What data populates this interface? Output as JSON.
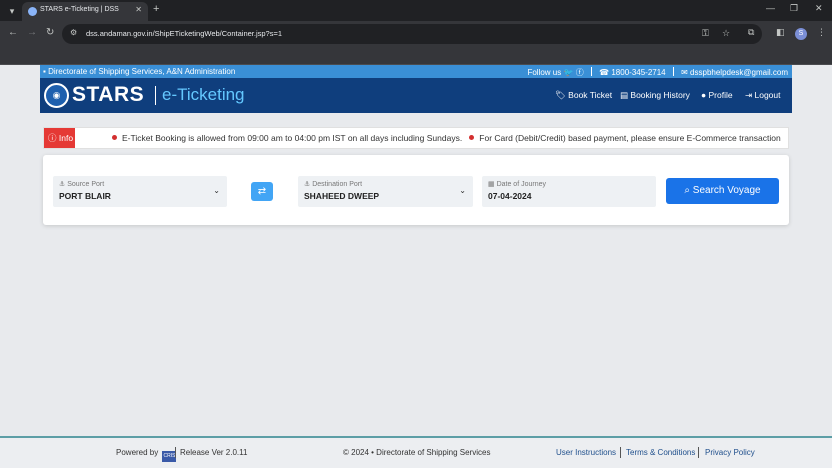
{
  "browser": {
    "tab_title": "STARS e-Ticketing | DSS",
    "tab_close": "✕",
    "new_tab": "+",
    "url": "dss.andaman.gov.in/ShipETicketingWeb/Container.jsp?s=1",
    "profile_initial": "S"
  },
  "site": {
    "department": "Directorate of Shipping Services, A&N Administration",
    "follow_us": "Follow us",
    "phone": "1800-345-2714",
    "email": "dsspbhelpdesk@gmail.com",
    "brand": "STARS",
    "brand_sub": "e-Ticketing",
    "nav": {
      "book_ticket": "Book Ticket",
      "booking_history": "Booking History",
      "profile": "Profile",
      "logout": "Logout"
    }
  },
  "ticker": {
    "badge": "Info",
    "messages": [
      "E-Ticket Booking is allowed from 09:00 am to 04:00 pm IST on all days including Sundays.",
      "For Card (Debit/Credit) based payment, please ensure E-Commerce transaction"
    ]
  },
  "search": {
    "source_label": "Source Port",
    "source_value": "PORT BLAIR",
    "destination_label": "Destination Port",
    "destination_value": "SHAHEED DWEEP",
    "date_label": "Date of Journey",
    "date_value": "07-04-2024",
    "button": "Search Voyage"
  },
  "footer": {
    "powered_by": "Powered by",
    "cris": "CRIS",
    "release": "Release Ver 2.0.11",
    "copyright": "© 2024 • Directorate of Shipping Services",
    "links": {
      "user_instructions": "User Instructions",
      "terms": "Terms & Conditions",
      "privacy": "Privacy Policy"
    }
  },
  "colors": {
    "header_bg": "#0f3e7d",
    "top_strip": "#3a8fd6",
    "accent_button": "#1a73e8",
    "info_badge": "#e53935"
  }
}
